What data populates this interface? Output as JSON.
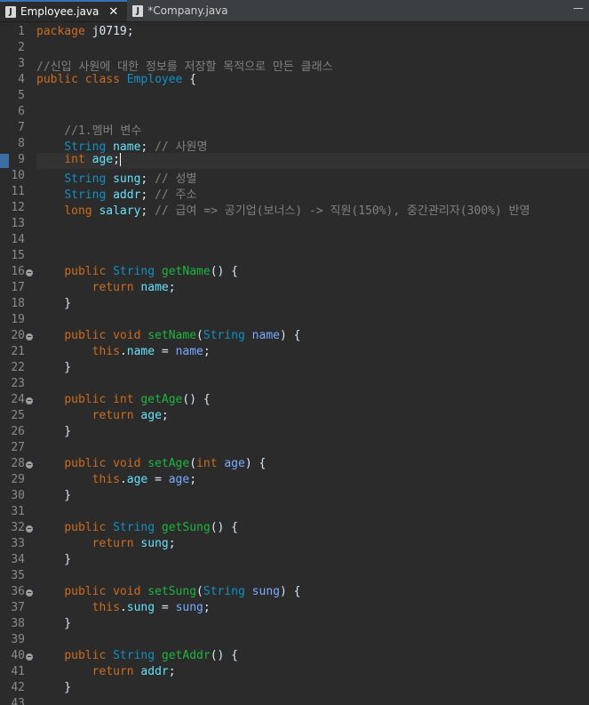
{
  "tabs": [
    {
      "label": "Employee.java",
      "active": true
    },
    {
      "label": "*Company.java",
      "active": false
    }
  ],
  "window_buttons": {
    "minimize": "—",
    "restore": "❐"
  },
  "lines": [
    {
      "n": "1",
      "tokens": [
        [
          "kw",
          "package"
        ],
        [
          "plain",
          " j0719;"
        ]
      ]
    },
    {
      "n": "2",
      "tokens": []
    },
    {
      "n": "3",
      "tokens": [
        [
          "comment",
          "//신입 사원에 대한 정보를 저장할 목적으로 만든 클래스"
        ]
      ]
    },
    {
      "n": "4",
      "tokens": [
        [
          "kw",
          "public"
        ],
        [
          "plain",
          " "
        ],
        [
          "kw",
          "class"
        ],
        [
          "plain",
          " "
        ],
        [
          "cls",
          "Employee"
        ],
        [
          "plain",
          " {"
        ]
      ]
    },
    {
      "n": "5",
      "tokens": []
    },
    {
      "n": "6",
      "tokens": []
    },
    {
      "n": "7",
      "tokens": [
        [
          "plain",
          "    "
        ],
        [
          "comment",
          "//1.멤버 변수"
        ]
      ]
    },
    {
      "n": "8",
      "tokens": [
        [
          "plain",
          "    "
        ],
        [
          "type",
          "String"
        ],
        [
          "plain",
          " "
        ],
        [
          "field",
          "name"
        ],
        [
          "plain",
          "; "
        ],
        [
          "comment",
          "// 사원명"
        ]
      ]
    },
    {
      "n": "9",
      "tokens": [
        [
          "plain",
          "    "
        ],
        [
          "kw",
          "int"
        ],
        [
          "plain",
          " "
        ],
        [
          "field",
          "age"
        ],
        [
          "plain",
          ";"
        ]
      ],
      "current": true
    },
    {
      "n": "10",
      "tokens": [
        [
          "plain",
          "    "
        ],
        [
          "type",
          "String"
        ],
        [
          "plain",
          " "
        ],
        [
          "field",
          "sung"
        ],
        [
          "plain",
          "; "
        ],
        [
          "comment",
          "// 성별"
        ]
      ]
    },
    {
      "n": "11",
      "tokens": [
        [
          "plain",
          "    "
        ],
        [
          "type",
          "String"
        ],
        [
          "plain",
          " "
        ],
        [
          "field",
          "addr"
        ],
        [
          "plain",
          "; "
        ],
        [
          "comment",
          "// 주소"
        ]
      ]
    },
    {
      "n": "12",
      "tokens": [
        [
          "plain",
          "    "
        ],
        [
          "kw",
          "long"
        ],
        [
          "plain",
          " "
        ],
        [
          "field",
          "salary"
        ],
        [
          "plain",
          "; "
        ],
        [
          "comment",
          "// 급여 => 공기업(보너스) -> 직원(150%), 중간관리자(300%) 반영"
        ]
      ]
    },
    {
      "n": "13",
      "tokens": []
    },
    {
      "n": "14",
      "tokens": []
    },
    {
      "n": "15",
      "tokens": []
    },
    {
      "n": "16",
      "fold": true,
      "tokens": [
        [
          "plain",
          "    "
        ],
        [
          "kw",
          "public"
        ],
        [
          "plain",
          " "
        ],
        [
          "type",
          "String"
        ],
        [
          "plain",
          " "
        ],
        [
          "method",
          "getName"
        ],
        [
          "plain",
          "() {"
        ]
      ]
    },
    {
      "n": "17",
      "tokens": [
        [
          "plain",
          "        "
        ],
        [
          "kw",
          "return"
        ],
        [
          "plain",
          " "
        ],
        [
          "field",
          "name"
        ],
        [
          "plain",
          ";"
        ]
      ]
    },
    {
      "n": "18",
      "tokens": [
        [
          "plain",
          "    }"
        ]
      ]
    },
    {
      "n": "19",
      "tokens": []
    },
    {
      "n": "20",
      "fold": true,
      "tokens": [
        [
          "plain",
          "    "
        ],
        [
          "kw",
          "public"
        ],
        [
          "plain",
          " "
        ],
        [
          "kw",
          "void"
        ],
        [
          "plain",
          " "
        ],
        [
          "method",
          "setName"
        ],
        [
          "plain",
          "("
        ],
        [
          "type",
          "String"
        ],
        [
          "plain",
          " "
        ],
        [
          "param",
          "name"
        ],
        [
          "plain",
          ") {"
        ]
      ]
    },
    {
      "n": "21",
      "tokens": [
        [
          "plain",
          "        "
        ],
        [
          "kw",
          "this"
        ],
        [
          "plain",
          "."
        ],
        [
          "field",
          "name"
        ],
        [
          "plain",
          " = "
        ],
        [
          "param",
          "name"
        ],
        [
          "plain",
          ";"
        ]
      ]
    },
    {
      "n": "22",
      "tokens": [
        [
          "plain",
          "    }"
        ]
      ]
    },
    {
      "n": "23",
      "tokens": []
    },
    {
      "n": "24",
      "fold": true,
      "tokens": [
        [
          "plain",
          "    "
        ],
        [
          "kw",
          "public"
        ],
        [
          "plain",
          " "
        ],
        [
          "kw",
          "int"
        ],
        [
          "plain",
          " "
        ],
        [
          "method",
          "getAge"
        ],
        [
          "plain",
          "() {"
        ]
      ]
    },
    {
      "n": "25",
      "tokens": [
        [
          "plain",
          "        "
        ],
        [
          "kw",
          "return"
        ],
        [
          "plain",
          " "
        ],
        [
          "field",
          "age"
        ],
        [
          "plain",
          ";"
        ]
      ]
    },
    {
      "n": "26",
      "tokens": [
        [
          "plain",
          "    }"
        ]
      ]
    },
    {
      "n": "27",
      "tokens": []
    },
    {
      "n": "28",
      "fold": true,
      "tokens": [
        [
          "plain",
          "    "
        ],
        [
          "kw",
          "public"
        ],
        [
          "plain",
          " "
        ],
        [
          "kw",
          "void"
        ],
        [
          "plain",
          " "
        ],
        [
          "method",
          "setAge"
        ],
        [
          "plain",
          "("
        ],
        [
          "kw",
          "int"
        ],
        [
          "plain",
          " "
        ],
        [
          "param",
          "age"
        ],
        [
          "plain",
          ") {"
        ]
      ]
    },
    {
      "n": "29",
      "tokens": [
        [
          "plain",
          "        "
        ],
        [
          "kw",
          "this"
        ],
        [
          "plain",
          "."
        ],
        [
          "field",
          "age"
        ],
        [
          "plain",
          " = "
        ],
        [
          "param",
          "age"
        ],
        [
          "plain",
          ";"
        ]
      ]
    },
    {
      "n": "30",
      "tokens": [
        [
          "plain",
          "    }"
        ]
      ]
    },
    {
      "n": "31",
      "tokens": []
    },
    {
      "n": "32",
      "fold": true,
      "tokens": [
        [
          "plain",
          "    "
        ],
        [
          "kw",
          "public"
        ],
        [
          "plain",
          " "
        ],
        [
          "type",
          "String"
        ],
        [
          "plain",
          " "
        ],
        [
          "method",
          "getSung"
        ],
        [
          "plain",
          "() {"
        ]
      ]
    },
    {
      "n": "33",
      "tokens": [
        [
          "plain",
          "        "
        ],
        [
          "kw",
          "return"
        ],
        [
          "plain",
          " "
        ],
        [
          "field",
          "sung"
        ],
        [
          "plain",
          ";"
        ]
      ]
    },
    {
      "n": "34",
      "tokens": [
        [
          "plain",
          "    }"
        ]
      ]
    },
    {
      "n": "35",
      "tokens": []
    },
    {
      "n": "36",
      "fold": true,
      "tokens": [
        [
          "plain",
          "    "
        ],
        [
          "kw",
          "public"
        ],
        [
          "plain",
          " "
        ],
        [
          "kw",
          "void"
        ],
        [
          "plain",
          " "
        ],
        [
          "method",
          "setSung"
        ],
        [
          "plain",
          "("
        ],
        [
          "type",
          "String"
        ],
        [
          "plain",
          " "
        ],
        [
          "param",
          "sung"
        ],
        [
          "plain",
          ") {"
        ]
      ]
    },
    {
      "n": "37",
      "tokens": [
        [
          "plain",
          "        "
        ],
        [
          "kw",
          "this"
        ],
        [
          "plain",
          "."
        ],
        [
          "field",
          "sung"
        ],
        [
          "plain",
          " = "
        ],
        [
          "param",
          "sung"
        ],
        [
          "plain",
          ";"
        ]
      ]
    },
    {
      "n": "38",
      "tokens": [
        [
          "plain",
          "    }"
        ]
      ]
    },
    {
      "n": "39",
      "tokens": []
    },
    {
      "n": "40",
      "fold": true,
      "tokens": [
        [
          "plain",
          "    "
        ],
        [
          "kw",
          "public"
        ],
        [
          "plain",
          " "
        ],
        [
          "type",
          "String"
        ],
        [
          "plain",
          " "
        ],
        [
          "method",
          "getAddr"
        ],
        [
          "plain",
          "() {"
        ]
      ]
    },
    {
      "n": "41",
      "tokens": [
        [
          "plain",
          "        "
        ],
        [
          "kw",
          "return"
        ],
        [
          "plain",
          " "
        ],
        [
          "field",
          "addr"
        ],
        [
          "plain",
          ";"
        ]
      ]
    },
    {
      "n": "42",
      "tokens": [
        [
          "plain",
          "    }"
        ]
      ]
    },
    {
      "n": "43",
      "tokens": []
    }
  ],
  "colors": {
    "background": "#2b2b2b",
    "keyword": "#cc6c1d",
    "type": "#1290c3",
    "method": "#1eb540",
    "field": "#66e1f8",
    "comment": "#808080"
  }
}
